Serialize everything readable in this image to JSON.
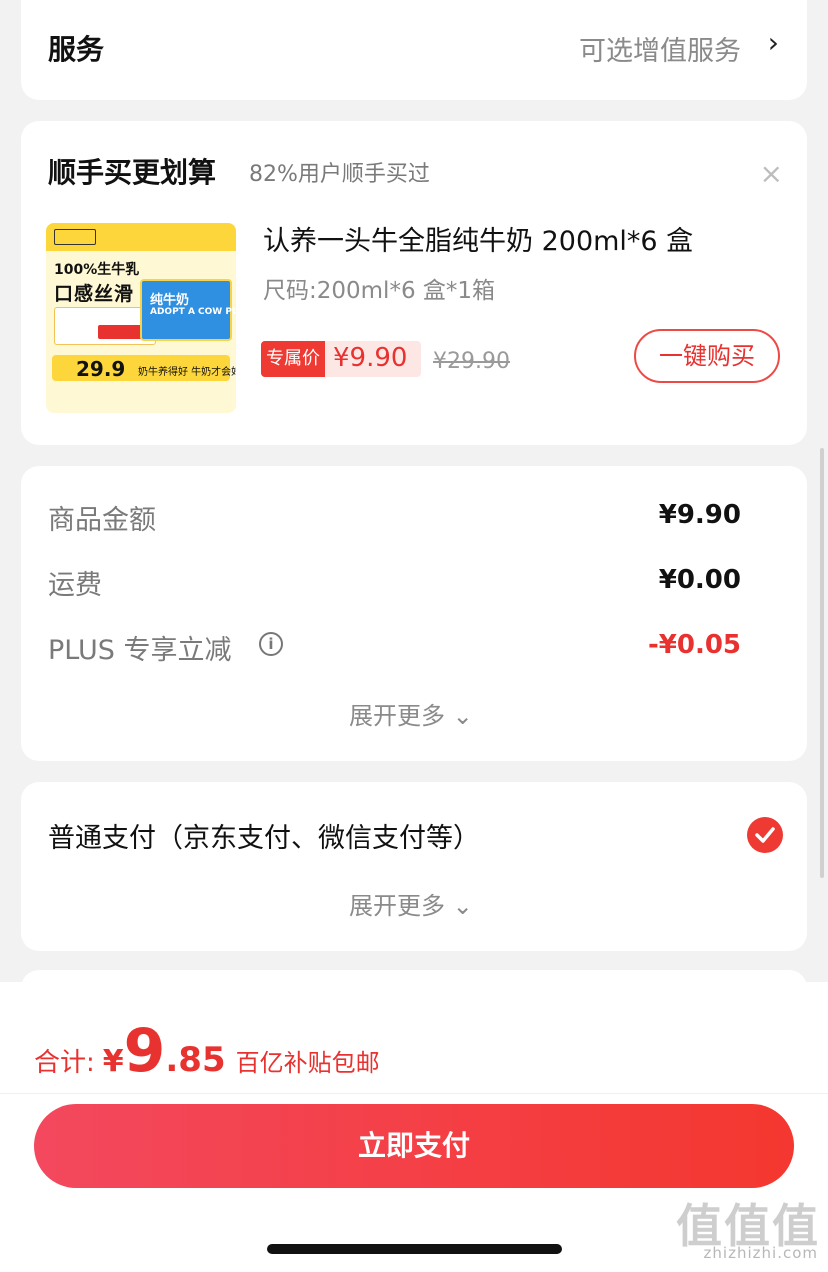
{
  "service": {
    "title": "服务",
    "value": "可选增值服务",
    "chevron": "›"
  },
  "upsell": {
    "title": "顺手买更划算",
    "subtitle": "82%用户顺手买过",
    "close": "×",
    "product": {
      "image_text_1": "100%生牛乳",
      "image_text_2": "口感丝滑",
      "image_box_title": "纯牛奶",
      "image_box_sub": "ADOPT A COW PURE MILK",
      "image_price": "29.9",
      "image_slogan": "奶牛养得好 牛奶才会好",
      "name": "认养一头牛全脂纯牛奶 200ml*6 盒",
      "spec": "尺码:200ml*6 盒*1箱",
      "exclusive_tag": "专属价",
      "exclusive_price": "¥9.90",
      "original_price": "¥29.90",
      "buy_label": "一键购买"
    }
  },
  "amounts": {
    "rows": [
      {
        "label": "商品金额",
        "value": "¥9.90"
      },
      {
        "label": "运费",
        "value": "¥0.00"
      },
      {
        "label": "PLUS 专享立减",
        "value": "-¥0.05"
      }
    ],
    "info_icon": "i",
    "expand": "展开更多 ⌄"
  },
  "payment": {
    "method": "普通支付（京东支付、微信支付等）",
    "expand": "展开更多 ⌄"
  },
  "footer": {
    "total_label": "合计:",
    "yen": "¥",
    "total_int": "9",
    "total_dec": ".85",
    "note": "百亿补贴包邮",
    "pay_label": "立即支付"
  },
  "watermark": {
    "logo": "值值值",
    "domain": "zhizhizhi.com"
  },
  "colors": {
    "accent": "#e8322f",
    "button_start": "#f3485e",
    "button_end": "#f4372f"
  }
}
